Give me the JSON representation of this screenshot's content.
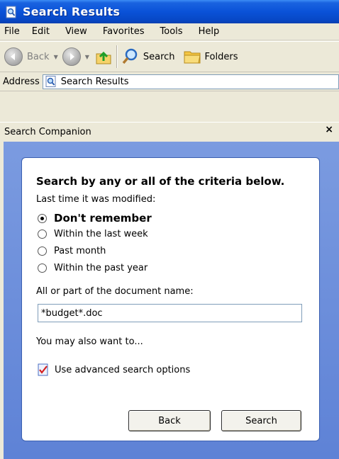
{
  "window": {
    "title": "Search Results",
    "icon": "search-results-icon"
  },
  "menubar": {
    "items": [
      "File",
      "Edit",
      "View",
      "Favorites",
      "Tools",
      "Help"
    ]
  },
  "toolbar": {
    "back_label": "Back",
    "search_label": "Search",
    "folders_label": "Folders"
  },
  "address": {
    "label": "Address",
    "value": "Search Results"
  },
  "pane": {
    "title": "Search Companion",
    "close": "×",
    "heading": "Search by any or all of the criteria below.",
    "modified_label": "Last time it was modified:",
    "options": [
      "Don't remember",
      "Within the last week",
      "Past month",
      "Within the past year"
    ],
    "selected_option": 0,
    "name_label": "All or part of the document name:",
    "name_value": "*budget*.doc",
    "also_label": "You may also want to...",
    "advanced_link": "Use advanced search options",
    "back_button": "Back",
    "search_button": "Search"
  },
  "colors": {
    "title_bar": "#0a52d8",
    "pane_background": "#6b8ad4",
    "chrome": "#ece9d8"
  }
}
